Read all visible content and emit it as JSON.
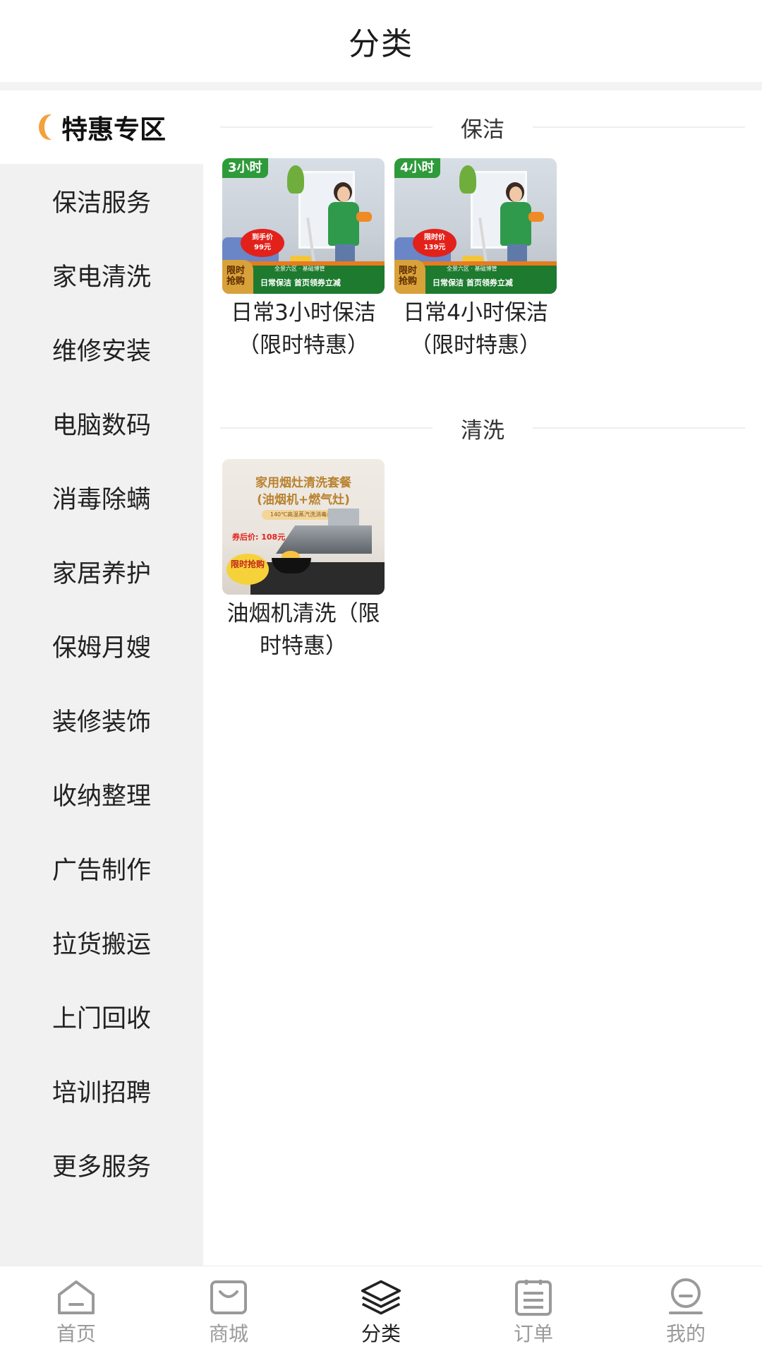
{
  "header": {
    "title": "分类"
  },
  "sidebar": {
    "active": {
      "label": "特惠专区"
    },
    "items": [
      {
        "label": "保洁服务"
      },
      {
        "label": "家电清洗"
      },
      {
        "label": "维修安装"
      },
      {
        "label": "电脑数码"
      },
      {
        "label": "消毒除螨"
      },
      {
        "label": "家居养护"
      },
      {
        "label": "保姆月嫂"
      },
      {
        "label": "装修装饰"
      },
      {
        "label": "收纳整理"
      },
      {
        "label": "广告制作"
      },
      {
        "label": "拉货搬运"
      },
      {
        "label": "上门回收"
      },
      {
        "label": "培训招聘"
      },
      {
        "label": "更多服务"
      }
    ]
  },
  "sections": [
    {
      "title": "保洁",
      "products": [
        {
          "title": "日常3小时保洁（限时特惠）",
          "image": {
            "tag": "3小时",
            "price_label": "到手价",
            "price": "99元",
            "limit": "限时抢购",
            "banner": "日常保洁  首页领券立减",
            "area": "全景六区 · 基础博管"
          }
        },
        {
          "title": "日常4小时保洁（限时特惠）",
          "image": {
            "tag": "4小时",
            "price_label": "限时价",
            "price": "139元",
            "limit": "限时抢购",
            "banner": "日常保洁  首页领券立减",
            "area": "全景六区 · 基础博管"
          }
        }
      ]
    },
    {
      "title": "清洗",
      "products": [
        {
          "title": "油烟机清洗（限时特惠）",
          "image": {
            "headline_1": "家用烟灶清洗套餐",
            "headline_2": "(油烟机+燃气灶)",
            "sub": "140℃高温蒸汽洗消毒杀菌",
            "price": "券后价: 108元",
            "limit": "限时抢购"
          }
        }
      ]
    }
  ],
  "tabbar": {
    "items": [
      {
        "label": "首页",
        "icon": "home-icon"
      },
      {
        "label": "商城",
        "icon": "shop-bag-icon"
      },
      {
        "label": "分类",
        "icon": "layers-icon",
        "active": true
      },
      {
        "label": "订单",
        "icon": "clipboard-icon"
      },
      {
        "label": "我的",
        "icon": "profile-icon"
      }
    ],
    "active_color": "#222222",
    "inactive_color": "#9a9a9a"
  },
  "colors": {
    "accent": "#f3a13b",
    "sidebar_bg": "#f1f1f1"
  }
}
